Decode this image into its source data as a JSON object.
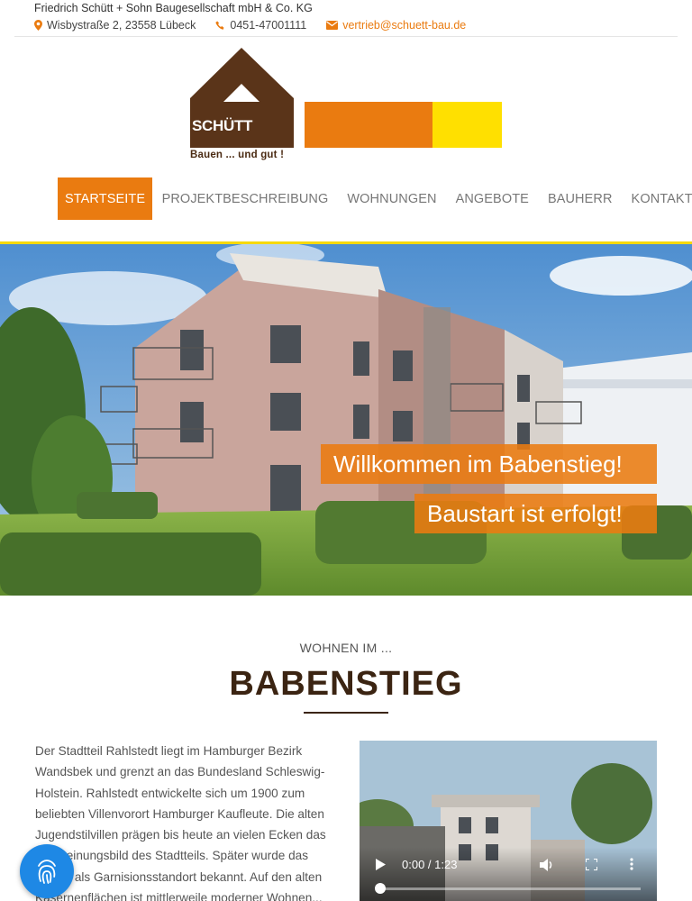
{
  "topbar": {
    "company": "Friedrich Schütt + Sohn Baugesellschaft mbH & Co. KG",
    "address": "Wisbystraße 2, 23558 Lübeck",
    "phone": "0451-47001111",
    "email": "vertrieb@schuett-bau.de"
  },
  "logo": {
    "word": "SCHÜTT",
    "slogan": "Bauen ... und gut !"
  },
  "nav": {
    "items": [
      "Startseite",
      "Projektbeschreibung",
      "Wohnungen",
      "Angebote",
      "Bauherr",
      "Kontakt"
    ],
    "active_index": 0
  },
  "hero": {
    "banner_line1": "Willkommen im Babenstieg!",
    "banner_line2": "Baustart ist erfolgt!"
  },
  "section": {
    "kicker": "WOHNEN IM ...",
    "title": "BABENSTIEG",
    "body": "Der Stadtteil Rahlstedt liegt im Hamburger Bezirk Wandsbek und grenzt an das Bundesland Schleswig-Holstein. Rahlstedt entwickelte sich um 1900 zum beliebten Villenvorort Hamburger Kaufleute. Die alten Jugendstilvillen prägen bis heute an vielen Ecken das Erscheinungsbild des Stadtteils. Später wurde das Gebiet als Garnisionsstandort bekannt. Auf den alten Kasernenflächen ist mittlerweile moderner Wohnen..."
  },
  "video": {
    "time": "0:00 / 1:23",
    "progress": 0
  },
  "colors": {
    "accent": "#ea7b10",
    "yellow": "#f6d90b",
    "brown": "#5a3419",
    "fab": "#1e88e5"
  },
  "icons": {
    "address": "map-marker-icon",
    "phone": "phone-icon",
    "email": "envelope-icon",
    "fab": "fingerprint-icon"
  }
}
